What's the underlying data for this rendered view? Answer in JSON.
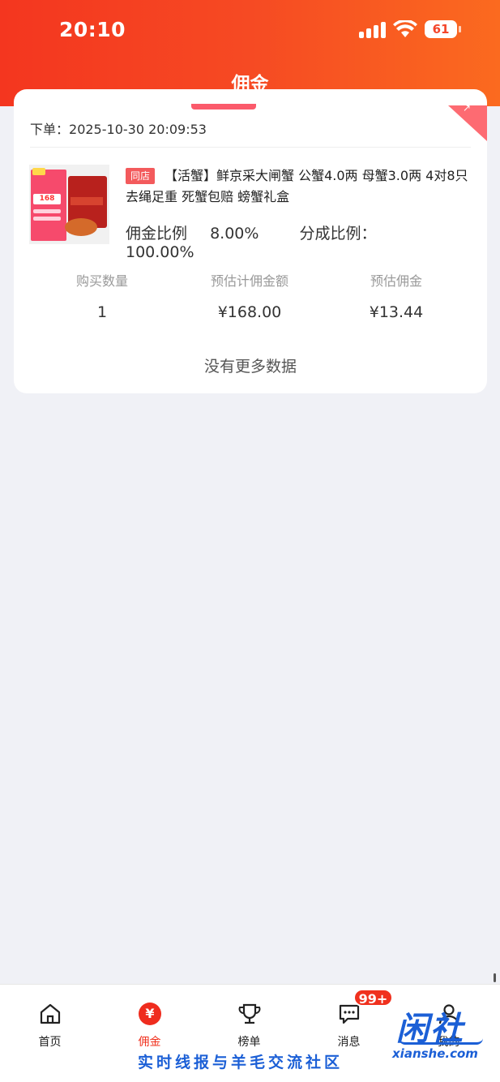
{
  "status_bar": {
    "time": "20:10",
    "battery": "61"
  },
  "header": {
    "title": "佣金"
  },
  "order": {
    "time_label": "下单：",
    "time_value": "2025-10-30 20:09:53",
    "product": {
      "image_price": "168",
      "shop_tag": "同店",
      "title": "【活蟹】鲜京采大闸蟹 公蟹4.0两 母蟹3.0两 4对8只 去绳足重 死蟹包赔 螃蟹礼盒",
      "commission_rate_label": "佣金比例",
      "commission_rate": "8.00%",
      "share_rate_label": "分成比例：",
      "share_rate": "100.00%"
    },
    "stats": [
      {
        "label": "购买数量",
        "value": "1"
      },
      {
        "label": "预估计佣金额",
        "value": "¥168.00"
      },
      {
        "label": "预估佣金",
        "value": "¥13.44"
      }
    ],
    "footer_text": "没有更多数据"
  },
  "tabbar": {
    "items": [
      {
        "label": "首页",
        "icon": "home-icon"
      },
      {
        "label": "佣金",
        "icon": "yen-icon",
        "active": true
      },
      {
        "label": "榜单",
        "icon": "trophy-icon"
      },
      {
        "label": "消息",
        "icon": "message-icon",
        "badge": "99+"
      },
      {
        "label": "我的",
        "icon": "user-icon"
      }
    ]
  },
  "watermark": {
    "logo": "闲社",
    "domain": "xianshe.com",
    "slogan": "实时线报与羊毛交流社区"
  },
  "colors": {
    "accent": "#f0311e",
    "tag": "#f35a5c",
    "watermark": "#1b5fd6"
  }
}
